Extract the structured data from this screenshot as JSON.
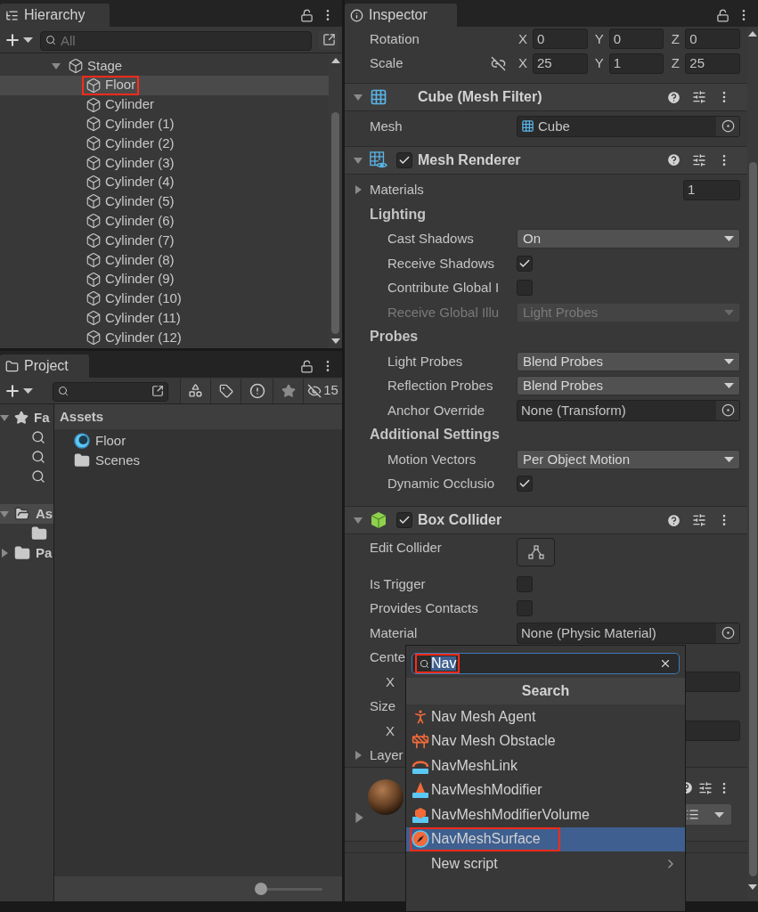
{
  "hierarchy": {
    "tab": "Hierarchy",
    "search": {
      "placeholder": "All"
    },
    "items": [
      {
        "label": "Stage",
        "expanded": true,
        "selected": false,
        "highlighted": false,
        "children": [
          {
            "label": "Floor",
            "selected": true,
            "highlighted": true
          },
          {
            "label": "Cylinder",
            "selected": false,
            "highlighted": false
          },
          {
            "label": "Cylinder (1)",
            "selected": false,
            "highlighted": false
          },
          {
            "label": "Cylinder (2)",
            "selected": false,
            "highlighted": false
          },
          {
            "label": "Cylinder (3)",
            "selected": false,
            "highlighted": false
          },
          {
            "label": "Cylinder (4)",
            "selected": false,
            "highlighted": false
          },
          {
            "label": "Cylinder (5)",
            "selected": false,
            "highlighted": false
          },
          {
            "label": "Cylinder (6)",
            "selected": false,
            "highlighted": false
          },
          {
            "label": "Cylinder (7)",
            "selected": false,
            "highlighted": false
          },
          {
            "label": "Cylinder (8)",
            "selected": false,
            "highlighted": false
          },
          {
            "label": "Cylinder (9)",
            "selected": false,
            "highlighted": false
          },
          {
            "label": "Cylinder (10)",
            "selected": false,
            "highlighted": false
          },
          {
            "label": "Cylinder (11)",
            "selected": false,
            "highlighted": false
          },
          {
            "label": "Cylinder (12)",
            "selected": false,
            "highlighted": false
          }
        ]
      }
    ]
  },
  "project": {
    "tab": "Project",
    "hidden_count": "15",
    "tree": [
      {
        "label": "Fa",
        "kind": "favorites",
        "expanded": true,
        "selected": false,
        "children": [
          {
            "kind": "saved_search"
          },
          {
            "kind": "saved_search"
          },
          {
            "kind": "saved_search"
          }
        ]
      },
      {
        "label": "As",
        "kind": "folder",
        "expanded": true,
        "selected": true,
        "children": [
          {
            "kind": "folder"
          }
        ]
      },
      {
        "label": "Pa",
        "kind": "folder",
        "expanded": false,
        "selected": false
      }
    ],
    "breadcrumb": "Assets",
    "assets": [
      {
        "label": "Floor",
        "kind": "material"
      },
      {
        "label": "Scenes",
        "kind": "folder"
      }
    ],
    "zoom": {
      "level": 0
    }
  },
  "inspector": {
    "tab": "Inspector",
    "rows": [
      {
        "kind": "vector3",
        "label": "Rotation",
        "values": [
          {
            "axis": "X",
            "value": "0"
          },
          {
            "axis": "Y",
            "value": "0"
          },
          {
            "axis": "Z",
            "value": "0"
          }
        ]
      },
      {
        "kind": "vector3",
        "label": "Scale",
        "linked": false,
        "values": [
          {
            "axis": "X",
            "value": "25"
          },
          {
            "axis": "Y",
            "value": "1"
          },
          {
            "axis": "Z",
            "value": "25"
          }
        ]
      },
      {
        "kind": "mesh_filter",
        "title": "Cube (Mesh Filter)"
      },
      {
        "kind": "mesh_object",
        "label": "Mesh",
        "value": "Cube"
      },
      {
        "kind": "mesh_renderer",
        "title": "Mesh Renderer",
        "enabled": true
      },
      {
        "kind": "number",
        "label": "Materials",
        "expanded": false,
        "value": "1"
      },
      {
        "kind": "heading",
        "label": "Lighting",
        "rows": [
          {
            "kind": "dropdown",
            "label": "Cast Shadows",
            "value": "On",
            "disabled": false
          },
          {
            "kind": "checkbox",
            "label": "Receive Shadows",
            "checked": true
          },
          {
            "kind": "checkbox",
            "label": "Contribute Global I",
            "checked": false
          },
          {
            "kind": "dropdown",
            "label": "Receive Global Illu",
            "value": "Light Probes",
            "disabled": true
          }
        ]
      },
      {
        "kind": "heading",
        "label": "Probes",
        "rows": [
          {
            "kind": "dropdown",
            "label": "Light Probes",
            "value": "Blend Probes",
            "disabled": false
          },
          {
            "kind": "dropdown",
            "label": "Reflection Probes",
            "value": "Blend Probes",
            "disabled": false
          },
          {
            "kind": "object",
            "label": "Anchor Override",
            "value": "None (Transform)"
          }
        ]
      },
      {
        "kind": "heading",
        "label": "Additional Settings",
        "rows": [
          {
            "kind": "dropdown",
            "label": "Motion Vectors",
            "value": "Per Object Motion",
            "disabled": false
          },
          {
            "kind": "checkbox",
            "label": "Dynamic Occlusio",
            "checked": true
          }
        ]
      },
      {
        "kind": "box_collider",
        "title": "Box Collider",
        "enabled": true
      },
      {
        "kind": "button",
        "label": "Edit Collider"
      },
      {
        "kind": "checkbox",
        "label": "Is Trigger",
        "checked": false
      },
      {
        "kind": "checkbox",
        "label": "Provides Contacts",
        "checked": false
      },
      {
        "kind": "object",
        "label": "Material",
        "value": "None (Physic Material)"
      },
      {
        "kind": "wide_vector",
        "label": "Cente",
        "axis": "X"
      },
      {
        "kind": "wide_vector",
        "label": "Size",
        "axis": "X"
      },
      {
        "kind": "foldout",
        "label": "Layer",
        "expanded": false
      },
      {
        "kind": "material",
        "expanded": false
      }
    ]
  },
  "popup": {
    "search": {
      "value": "Nav",
      "highlighted": true
    },
    "header": "Search",
    "items": [
      {
        "label": "Nav Mesh Agent",
        "kind": "agent",
        "selected": false,
        "highlighted": false
      },
      {
        "label": "Nav Mesh Obstacle",
        "kind": "obstacle",
        "selected": false,
        "highlighted": false
      },
      {
        "label": "NavMeshLink",
        "kind": "link",
        "selected": false,
        "highlighted": false
      },
      {
        "label": "NavMeshModifier",
        "kind": "modifier",
        "selected": false,
        "highlighted": false
      },
      {
        "label": "NavMeshModifierVolume",
        "kind": "volume",
        "selected": false,
        "highlighted": false
      },
      {
        "label": "NavMeshSurface",
        "kind": "surface",
        "selected": true,
        "highlighted": true
      },
      {
        "label": "New script",
        "kind": "script",
        "selected": false,
        "highlighted": false
      }
    ]
  }
}
